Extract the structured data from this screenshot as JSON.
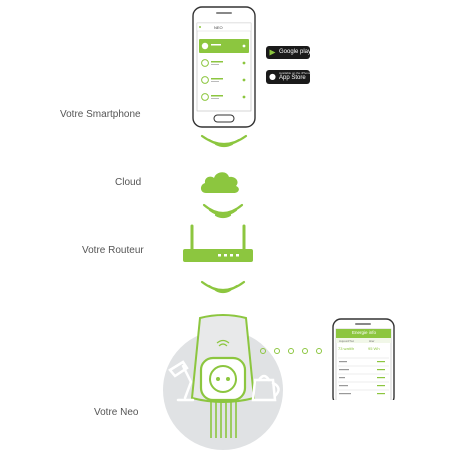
{
  "labels": {
    "smartphone": "Votre Smartphone",
    "cloud": "Cloud",
    "router": "Votre Routeur",
    "neo": "Votre Neo"
  },
  "phone_top": {
    "title": "NEO"
  },
  "stores": {
    "google_play": {
      "label": "Google play"
    },
    "app_store": {
      "sub": "Available on the iPhone",
      "label": "App Store"
    }
  },
  "phone_right": {
    "title": "Energie info",
    "col1": "Aujourd'hui",
    "col2": "Hier",
    "values": [
      "73 watt/h",
      "95 Wh"
    ]
  },
  "colors": {
    "accent": "#8cc63f",
    "text": "#555555",
    "phone_body": "#ffffff",
    "neo_circle": "#e0e2e4"
  },
  "icons": {
    "wifi_waves": "wifi-waves-icon",
    "cloud": "cloud-icon",
    "router": "router-icon",
    "lamp": "lamp-icon",
    "kettle": "kettle-icon",
    "plug": "smart-plug-icon"
  }
}
